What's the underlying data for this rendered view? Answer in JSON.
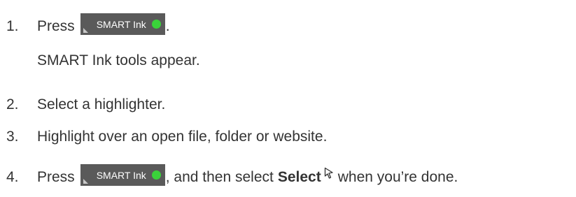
{
  "steps": [
    {
      "number": "1.",
      "text_before": "Press",
      "button_label": "SMART Ink",
      "text_after": ".",
      "result": "SMART Ink tools appear."
    },
    {
      "number": "2.",
      "text": "Select a highlighter."
    },
    {
      "number": "3.",
      "text": "Highlight over an open file, folder or website."
    },
    {
      "number": "4.",
      "text_before": "Press",
      "button_label": "SMART Ink",
      "text_middle": ", and then select",
      "bold_word": "Select",
      "text_after": "when you’re done."
    }
  ],
  "icons": {
    "button_status": "green-dot-icon",
    "button_corner": "corner-triangle-icon",
    "select_tool": "select-arrow-icon"
  },
  "colors": {
    "text": "#333333",
    "button_bg": "#5a5a5a",
    "status_dot": "#3ad33a"
  }
}
